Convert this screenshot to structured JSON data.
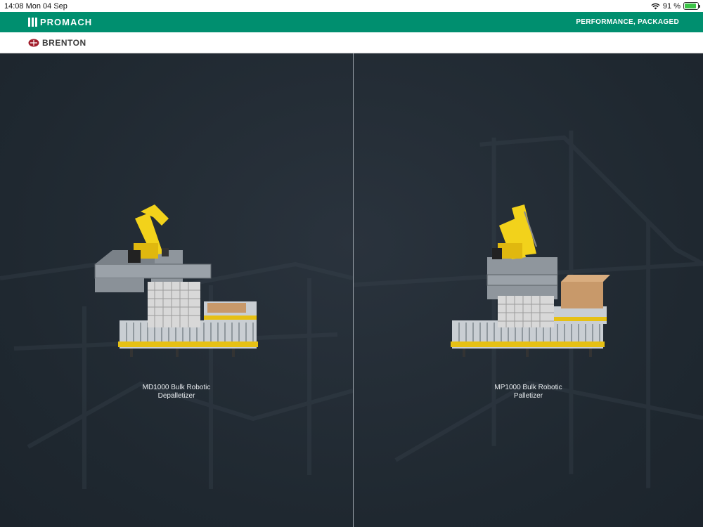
{
  "status": {
    "time": "14:08",
    "date": "Mon 04 Sep",
    "battery_percent": "91 %",
    "battery_level": 0.91
  },
  "header": {
    "brand": "PROMACH",
    "tagline": "PERFORMANCE, PACKAGED"
  },
  "subheader": {
    "brand": "BRENTON"
  },
  "products": [
    {
      "line1": "MD1000 Bulk Robotic",
      "line2": "Depalletizer"
    },
    {
      "line1": "MP1000 Bulk Robotic",
      "line2": "Palletizer"
    }
  ],
  "colors": {
    "accent": "#008f6f",
    "robot": "#f2d21b",
    "conveyor": "#e6c014",
    "background": "#222b35"
  }
}
